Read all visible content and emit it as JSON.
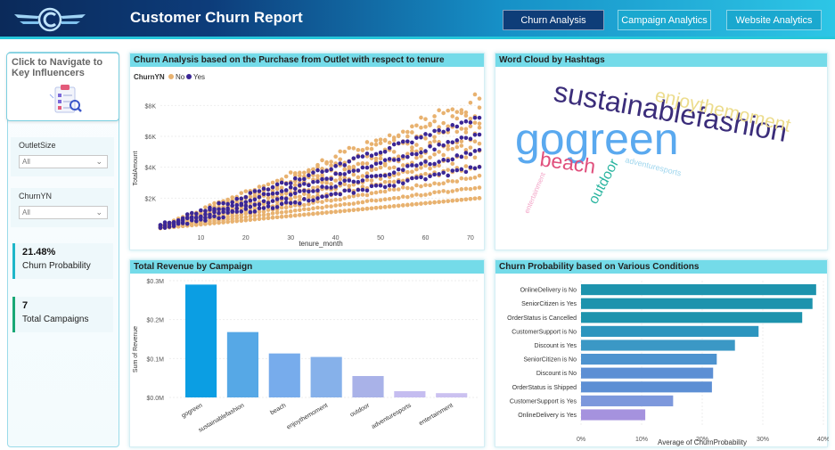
{
  "header": {
    "title": "Customer Churn Report",
    "nav": [
      "Churn Analysis",
      "Campaign Analytics",
      "Website Analytics"
    ]
  },
  "sidebar": {
    "nav_card": "Click to Navigate to Key Influencers",
    "slicers": [
      {
        "label": "OutletSize",
        "value": "All"
      },
      {
        "label": "ChurnYN",
        "value": "All"
      }
    ],
    "kpis": [
      {
        "value": "21.48%",
        "label": "Churn Probability",
        "color": "#1fb6c9"
      },
      {
        "value": "7",
        "label": "Total Campaigns",
        "color": "#19a876"
      }
    ]
  },
  "panels": {
    "scatter": "Churn Analysis based on the Purchase from Outlet with respect to tenure",
    "wordcloud": "Word Cloud by Hashtags",
    "revenue": "Total Revenue by Campaign",
    "churnprob": "Churn Probability based on Various Conditions"
  },
  "colors": {
    "no": "#e8b270",
    "yes": "#3b2796",
    "bar_revenue": [
      "#0b9ee3",
      "#56a8e6",
      "#77acec",
      "#86b1ea",
      "#a9b2e8",
      "#c5bdf0",
      "#cbc1f0"
    ],
    "bar_churn": [
      "#1d93ad",
      "#1d93ad",
      "#1d93ad",
      "#2c95be",
      "#3b98c5",
      "#4d93cf",
      "#5d8fd4",
      "#5d8fd4",
      "#7d98dc",
      "#a592de"
    ]
  },
  "wordcloud_words": [
    {
      "text": "gogreen",
      "color": "#5aa9ef"
    },
    {
      "text": "sustainablefashion",
      "color": "#3b2d7a"
    },
    {
      "text": "enjoythemoment",
      "color": "#ecdc8c"
    },
    {
      "text": "beach",
      "color": "#e04f7c"
    },
    {
      "text": "outdoor",
      "color": "#2bb5a0"
    },
    {
      "text": "adventuresports",
      "color": "#9fd6ee"
    },
    {
      "text": "entertainment",
      "color": "#f3a6c8"
    }
  ],
  "chart_data": [
    {
      "type": "scatter",
      "title": "Churn Analysis based on the Purchase from Outlet with respect to tenure",
      "legend_title": "ChurnYN",
      "series_names": [
        "No",
        "Yes"
      ],
      "xlabel": "tenure_month",
      "ylabel": "TotalAmount",
      "x_ticks": [
        10,
        20,
        30,
        40,
        50,
        60,
        70
      ],
      "y_ticks": [
        "$2K",
        "$4K",
        "$6K",
        "$8K"
      ],
      "x_range": [
        1,
        72
      ],
      "y_range": [
        0,
        9000
      ],
      "upper_line": [
        [
          1,
          200
        ],
        [
          72,
          8900
        ]
      ],
      "lower_line": [
        [
          1,
          50
        ],
        [
          72,
          2000
        ]
      ],
      "yes_line": [
        [
          1,
          250
        ],
        [
          72,
          7200
        ]
      ]
    },
    {
      "type": "bar",
      "title": "Total Revenue by Campaign",
      "ylabel": "Sum of Revenue",
      "categories": [
        "gogreen",
        "sustainablefashion",
        "beach",
        "enjoythemoment",
        "outdoor",
        "adventuresports",
        "entertainment"
      ],
      "values": [
        0.29,
        0.168,
        0.113,
        0.104,
        0.055,
        0.016,
        0.011
      ],
      "y_ticks": [
        "$0.0M",
        "$0.1M",
        "$0.2M",
        "$0.3M"
      ],
      "ylim": [
        0,
        0.3
      ]
    },
    {
      "type": "bar",
      "orientation": "horizontal",
      "title": "Churn Probability based on Various Conditions",
      "xlabel": "Average of ChurnProbability",
      "categories": [
        "OnlineDelivery is No",
        "SeniorCitizen is Yes",
        "OrderStatus is Cancelled",
        "CustomerSupport is No",
        "Discount is Yes",
        "SeniorCitizen is No",
        "Discount is No",
        "OrderStatus is Shipped",
        "CustomerSupport is Yes",
        "OnlineDelivery is Yes"
      ],
      "values": [
        0.388,
        0.382,
        0.365,
        0.293,
        0.254,
        0.224,
        0.218,
        0.216,
        0.152,
        0.106
      ],
      "x_ticks": [
        "0%",
        "10%",
        "20%",
        "30%",
        "40%"
      ],
      "xlim": [
        0,
        0.4
      ]
    }
  ]
}
